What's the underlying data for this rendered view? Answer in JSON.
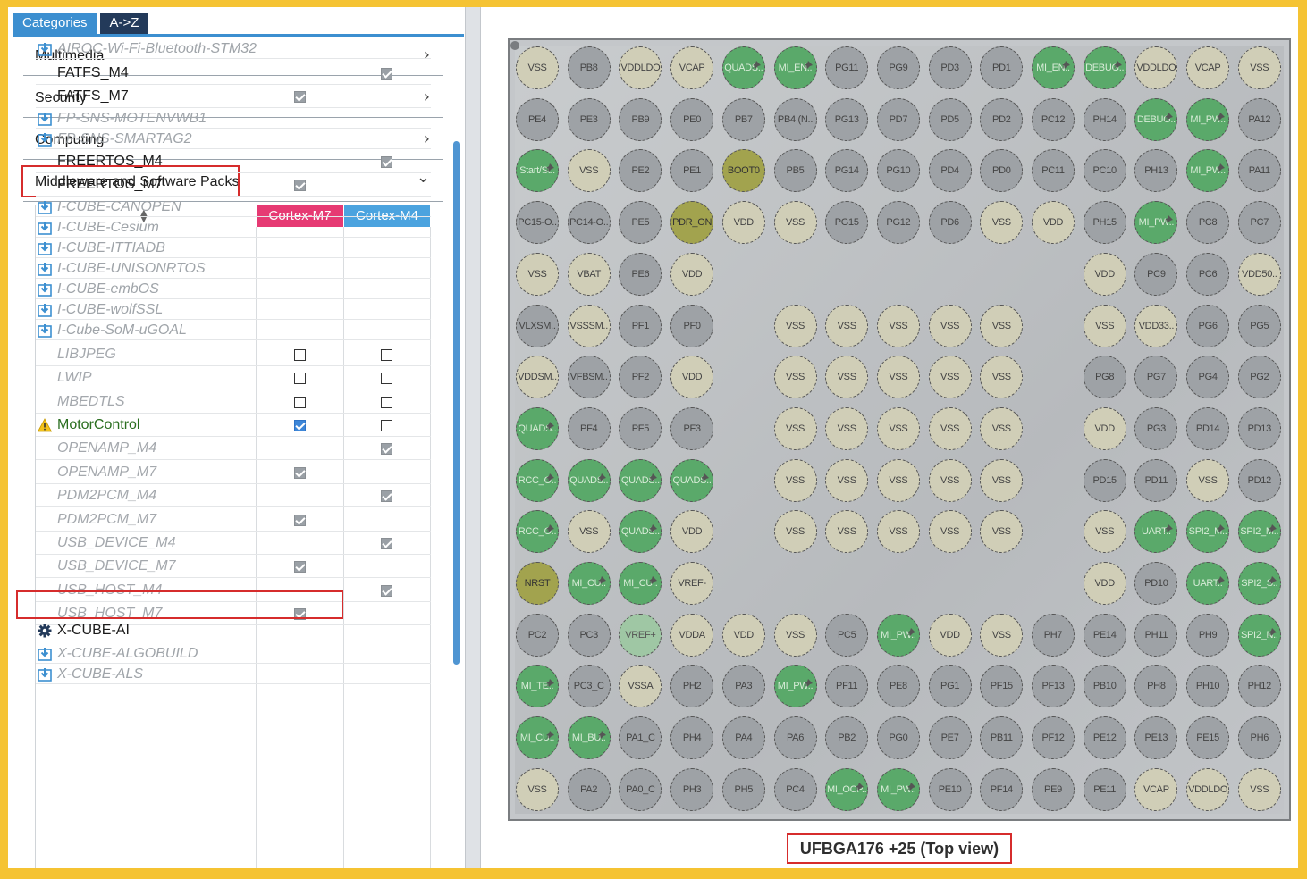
{
  "tabs": {
    "categories": "Categories",
    "az": "A->Z"
  },
  "sections": [
    "Multimedia",
    "Security",
    "Computing",
    "Middleware and Software Packs"
  ],
  "table": {
    "col_m7": "Cortex-M7",
    "col_m4": "Cortex-M4",
    "rows": [
      {
        "name": "AIROC-Wi-Fi-Bluetooth-STM32",
        "state": "dl",
        "m7": "",
        "m4": ""
      },
      {
        "name": "FATFS_M4",
        "state": "ena",
        "m7": "",
        "m4": "checked-gray"
      },
      {
        "name": "FATFS_M7",
        "state": "ena",
        "m7": "checked-gray",
        "m4": ""
      },
      {
        "name": "FP-SNS-MOTENVWB1",
        "state": "dl",
        "m7": "",
        "m4": ""
      },
      {
        "name": "FP-SNS-SMARTAG2",
        "state": "dl",
        "m7": "",
        "m4": ""
      },
      {
        "name": "FREERTOS_M4",
        "state": "ena",
        "m7": "",
        "m4": "checked-gray"
      },
      {
        "name": "FREERTOS_M7",
        "state": "ena",
        "m7": "checked-gray",
        "m4": ""
      },
      {
        "name": "I-CUBE-CANOPEN",
        "state": "dl",
        "m7": "",
        "m4": ""
      },
      {
        "name": "I-CUBE-Cesium",
        "state": "dl",
        "m7": "",
        "m4": ""
      },
      {
        "name": "I-CUBE-ITTIADB",
        "state": "dl",
        "m7": "",
        "m4": ""
      },
      {
        "name": "I-CUBE-UNISONRTOS",
        "state": "dl",
        "m7": "",
        "m4": ""
      },
      {
        "name": "I-CUBE-embOS",
        "state": "dl",
        "m7": "",
        "m4": ""
      },
      {
        "name": "I-CUBE-wolfSSL",
        "state": "dl",
        "m7": "",
        "m4": ""
      },
      {
        "name": "I-Cube-SoM-uGOAL",
        "state": "dl",
        "m7": "",
        "m4": ""
      },
      {
        "name": "LIBJPEG",
        "state": "dis",
        "m7": "empty",
        "m4": "empty"
      },
      {
        "name": "LWIP",
        "state": "dis",
        "m7": "empty",
        "m4": "empty"
      },
      {
        "name": "MBEDTLS",
        "state": "dis",
        "m7": "empty",
        "m4": "empty"
      },
      {
        "name": "MotorControl",
        "state": "mc",
        "m7": "checked-blue",
        "m4": "empty"
      },
      {
        "name": "OPENAMP_M4",
        "state": "dis",
        "m7": "",
        "m4": "checked-gray"
      },
      {
        "name": "OPENAMP_M7",
        "state": "dis",
        "m7": "checked-gray",
        "m4": ""
      },
      {
        "name": "PDM2PCM_M4",
        "state": "dis",
        "m7": "",
        "m4": "checked-gray"
      },
      {
        "name": "PDM2PCM_M7",
        "state": "dis",
        "m7": "checked-gray",
        "m4": ""
      },
      {
        "name": "USB_DEVICE_M4",
        "state": "dis",
        "m7": "",
        "m4": "checked-gray"
      },
      {
        "name": "USB_DEVICE_M7",
        "state": "dis",
        "m7": "checked-gray",
        "m4": ""
      },
      {
        "name": "USB_HOST_M4",
        "state": "dis",
        "m7": "",
        "m4": "checked-gray"
      },
      {
        "name": "USB_HOST_M7",
        "state": "dis",
        "m7": "checked-gray",
        "m4": ""
      },
      {
        "name": "X-CUBE-AI",
        "state": "ai",
        "m7": "",
        "m4": ""
      },
      {
        "name": "X-CUBE-ALGOBUILD",
        "state": "dl",
        "m7": "",
        "m4": ""
      },
      {
        "name": "X-CUBE-ALS",
        "state": "dl",
        "m7": "",
        "m4": ""
      }
    ]
  },
  "package": {
    "caption": "UFBGA176 +25 (Top view)",
    "pins": [
      [
        [
          "VSS",
          "p"
        ],
        [
          "PB8",
          "i"
        ],
        [
          "VDDLDO",
          "p"
        ],
        [
          "VCAP",
          "p"
        ],
        [
          "QUADS..",
          "g",
          1
        ],
        [
          "MI_EN..",
          "g",
          1
        ],
        [
          "PG11",
          "i"
        ],
        [
          "PG9",
          "i"
        ],
        [
          "PD3",
          "i"
        ],
        [
          "PD1",
          "i"
        ],
        [
          "MI_EN..",
          "g",
          1
        ],
        [
          "DEBUG..",
          "g",
          1
        ],
        [
          "VDDLDO",
          "p"
        ],
        [
          "VCAP",
          "p"
        ],
        [
          "VSS",
          "p"
        ]
      ],
      [
        [
          "PE4",
          "i"
        ],
        [
          "PE3",
          "i"
        ],
        [
          "PB9",
          "i"
        ],
        [
          "PE0",
          "i"
        ],
        [
          "PB7",
          "i"
        ],
        [
          "PB4 (N..",
          "i"
        ],
        [
          "PG13",
          "i"
        ],
        [
          "PD7",
          "i"
        ],
        [
          "PD5",
          "i"
        ],
        [
          "PD2",
          "i"
        ],
        [
          "PC12",
          "i"
        ],
        [
          "PH14",
          "i"
        ],
        [
          "DEBUG..",
          "g",
          1
        ],
        [
          "MI_PW..",
          "g",
          1
        ],
        [
          "PA12",
          "i"
        ]
      ],
      [
        [
          "Start/St..",
          "g",
          1
        ],
        [
          "VSS",
          "p"
        ],
        [
          "PE2",
          "i"
        ],
        [
          "PE1",
          "i"
        ],
        [
          "BOOT0",
          "y"
        ],
        [
          "PB5",
          "i"
        ],
        [
          "PG14",
          "i"
        ],
        [
          "PG10",
          "i"
        ],
        [
          "PD4",
          "i"
        ],
        [
          "PD0",
          "i"
        ],
        [
          "PC11",
          "i"
        ],
        [
          "PC10",
          "i"
        ],
        [
          "PH13",
          "i"
        ],
        [
          "MI_PW..",
          "g",
          1
        ],
        [
          "PA11",
          "i"
        ]
      ],
      [
        [
          "PC15-O..",
          "i"
        ],
        [
          "PC14-O..",
          "i"
        ],
        [
          "PE5",
          "i"
        ],
        [
          "PDR_ON",
          "y"
        ],
        [
          "VDD",
          "p"
        ],
        [
          "VSS",
          "p"
        ],
        [
          "PG15",
          "i"
        ],
        [
          "PG12",
          "i"
        ],
        [
          "PD6",
          "i"
        ],
        [
          "VSS",
          "p"
        ],
        [
          "VDD",
          "p"
        ],
        [
          "PH15",
          "i"
        ],
        [
          "MI_PW..",
          "g",
          1
        ],
        [
          "PC8",
          "i"
        ],
        [
          "PC7",
          "i"
        ]
      ],
      [
        [
          "VSS",
          "p"
        ],
        [
          "VBAT",
          "p"
        ],
        [
          "PE6",
          "i"
        ],
        [
          "VDD",
          "p"
        ],
        null,
        null,
        null,
        null,
        null,
        null,
        null,
        [
          "VDD",
          "p"
        ],
        [
          "PC9",
          "i"
        ],
        [
          "PC6",
          "i"
        ],
        [
          "VDD50..",
          "p"
        ]
      ],
      [
        [
          "VLXSM..",
          "i"
        ],
        [
          "VSSSM..",
          "p"
        ],
        [
          "PF1",
          "i"
        ],
        [
          "PF0",
          "i"
        ],
        null,
        [
          "VSS",
          "p"
        ],
        [
          "VSS",
          "p"
        ],
        [
          "VSS",
          "p"
        ],
        [
          "VSS",
          "p"
        ],
        [
          "VSS",
          "p"
        ],
        null,
        [
          "VSS",
          "p"
        ],
        [
          "VDD33..",
          "p"
        ],
        [
          "PG6",
          "i"
        ],
        [
          "PG5",
          "i"
        ]
      ],
      [
        [
          "VDDSM..",
          "p"
        ],
        [
          "VFBSM..",
          "i"
        ],
        [
          "PF2",
          "i"
        ],
        [
          "VDD",
          "p"
        ],
        null,
        [
          "VSS",
          "p"
        ],
        [
          "VSS",
          "p"
        ],
        [
          "VSS",
          "p"
        ],
        [
          "VSS",
          "p"
        ],
        [
          "VSS",
          "p"
        ],
        null,
        [
          "PG8",
          "i"
        ],
        [
          "PG7",
          "i"
        ],
        [
          "PG4",
          "i"
        ],
        [
          "PG2",
          "i"
        ]
      ],
      [
        [
          "QUADS..",
          "g",
          1
        ],
        [
          "PF4",
          "i"
        ],
        [
          "PF5",
          "i"
        ],
        [
          "PF3",
          "i"
        ],
        null,
        [
          "VSS",
          "p"
        ],
        [
          "VSS",
          "p"
        ],
        [
          "VSS",
          "p"
        ],
        [
          "VSS",
          "p"
        ],
        [
          "VSS",
          "p"
        ],
        null,
        [
          "VDD",
          "p"
        ],
        [
          "PG3",
          "i"
        ],
        [
          "PD14",
          "i"
        ],
        [
          "PD13",
          "i"
        ]
      ],
      [
        [
          "RCC_O..",
          "g",
          1
        ],
        [
          "QUADS..",
          "g",
          1
        ],
        [
          "QUADS..",
          "g",
          1
        ],
        [
          "QUADS..",
          "g",
          1
        ],
        null,
        [
          "VSS",
          "p"
        ],
        [
          "VSS",
          "p"
        ],
        [
          "VSS",
          "p"
        ],
        [
          "VSS",
          "p"
        ],
        [
          "VSS",
          "p"
        ],
        null,
        [
          "PD15",
          "i"
        ],
        [
          "PD11",
          "i"
        ],
        [
          "VSS",
          "p"
        ],
        [
          "PD12",
          "i"
        ]
      ],
      [
        [
          "RCC_O..",
          "g",
          1
        ],
        [
          "VSS",
          "p"
        ],
        [
          "QUADS..",
          "g",
          1
        ],
        [
          "VDD",
          "p"
        ],
        null,
        [
          "VSS",
          "p"
        ],
        [
          "VSS",
          "p"
        ],
        [
          "VSS",
          "p"
        ],
        [
          "VSS",
          "p"
        ],
        [
          "VSS",
          "p"
        ],
        null,
        [
          "VSS",
          "p"
        ],
        [
          "UART..",
          "g",
          1
        ],
        [
          "SPI2_M..",
          "g",
          1
        ],
        [
          "SPI2_M..",
          "g",
          1
        ]
      ],
      [
        [
          "NRST",
          "y"
        ],
        [
          "MI_CU..",
          "g",
          1
        ],
        [
          "MI_CU..",
          "g",
          1
        ],
        [
          "VREF-",
          "p"
        ],
        null,
        null,
        null,
        null,
        null,
        null,
        null,
        [
          "VDD",
          "p"
        ],
        [
          "PD10",
          "i"
        ],
        [
          "UART..",
          "g",
          1
        ],
        [
          "SPI2_S..",
          "g",
          1
        ]
      ],
      [
        [
          "PC2",
          "i"
        ],
        [
          "PC3",
          "i"
        ],
        [
          "VREF+",
          "gl"
        ],
        [
          "VDDA",
          "p"
        ],
        [
          "VDD",
          "p"
        ],
        [
          "VSS",
          "p"
        ],
        [
          "PC5",
          "i"
        ],
        [
          "MI_PW..",
          "g",
          1
        ],
        [
          "VDD",
          "p"
        ],
        [
          "VSS",
          "p"
        ],
        [
          "PH7",
          "i"
        ],
        [
          "PE14",
          "i"
        ],
        [
          "PH11",
          "i"
        ],
        [
          "PH9",
          "i"
        ],
        [
          "SPI2_N..",
          "g",
          1
        ]
      ],
      [
        [
          "MI_TE..",
          "g",
          1
        ],
        [
          "PC3_C",
          "i"
        ],
        [
          "VSSA",
          "p"
        ],
        [
          "PH2",
          "i"
        ],
        [
          "PA3",
          "i"
        ],
        [
          "MI_PW..",
          "g",
          1
        ],
        [
          "PF11",
          "i"
        ],
        [
          "PE8",
          "i"
        ],
        [
          "PG1",
          "i"
        ],
        [
          "PF15",
          "i"
        ],
        [
          "PF13",
          "i"
        ],
        [
          "PB10",
          "i"
        ],
        [
          "PH8",
          "i"
        ],
        [
          "PH10",
          "i"
        ],
        [
          "PH12",
          "i"
        ]
      ],
      [
        [
          "MI_CU..",
          "g",
          1
        ],
        [
          "MI_BU..",
          "g",
          1
        ],
        [
          "PA1_C",
          "i"
        ],
        [
          "PH4",
          "i"
        ],
        [
          "PA4",
          "i"
        ],
        [
          "PA6",
          "i"
        ],
        [
          "PB2",
          "i"
        ],
        [
          "PG0",
          "i"
        ],
        [
          "PE7",
          "i"
        ],
        [
          "PB11",
          "i"
        ],
        [
          "PF12",
          "i"
        ],
        [
          "PE12",
          "i"
        ],
        [
          "PE13",
          "i"
        ],
        [
          "PE15",
          "i"
        ],
        [
          "PH6",
          "i"
        ]
      ],
      [
        [
          "VSS",
          "p"
        ],
        [
          "PA2",
          "i"
        ],
        [
          "PA0_C",
          "i"
        ],
        [
          "PH3",
          "i"
        ],
        [
          "PH5",
          "i"
        ],
        [
          "PC4",
          "i"
        ],
        [
          "MI_OCP..",
          "g",
          1
        ],
        [
          "MI_PW..",
          "g",
          1
        ],
        [
          "PE10",
          "i"
        ],
        [
          "PF14",
          "i"
        ],
        [
          "PE9",
          "i"
        ],
        [
          "PE11",
          "i"
        ],
        [
          "VCAP",
          "p"
        ],
        [
          "VDDLDO",
          "p"
        ],
        [
          "VSS",
          "p"
        ]
      ]
    ]
  }
}
